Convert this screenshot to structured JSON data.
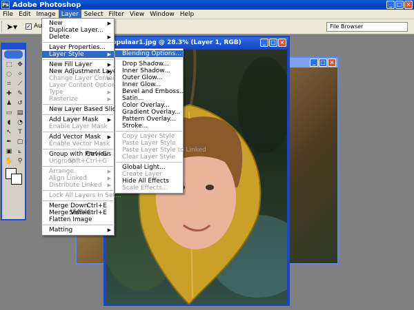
{
  "titlebar": {
    "title": "Adobe Photoshop"
  },
  "menubar": {
    "items": [
      "File",
      "Edit",
      "Image",
      "Layer",
      "Select",
      "Filter",
      "View",
      "Window",
      "Help"
    ]
  },
  "options_bar": {
    "auto_label": "Auto",
    "file_browser_label": "File Browser"
  },
  "document": {
    "title": "populaar1.jpg @ 28.3% (Layer 1, RGB)"
  },
  "layer_menu": {
    "items": [
      {
        "label": "New",
        "sub": true
      },
      {
        "label": "Duplicate Layer..."
      },
      {
        "label": "Delete",
        "sub": true
      },
      {
        "sep": true
      },
      {
        "label": "Layer Properties..."
      },
      {
        "label": "Layer Style",
        "sub": true,
        "hl": true
      },
      {
        "sep": true
      },
      {
        "label": "New Fill Layer",
        "sub": true
      },
      {
        "label": "New Adjustment Layer",
        "sub": true
      },
      {
        "label": "Change Layer Content",
        "sub": true,
        "disabled": true
      },
      {
        "label": "Layer Content Options...",
        "disabled": true
      },
      {
        "label": "Type",
        "sub": true,
        "disabled": true
      },
      {
        "label": "Rasterize",
        "sub": true,
        "disabled": true
      },
      {
        "sep": true
      },
      {
        "label": "New Layer Based Slice"
      },
      {
        "sep": true
      },
      {
        "label": "Add Layer Mask",
        "sub": true
      },
      {
        "label": "Enable Layer Mask",
        "disabled": true
      },
      {
        "sep": true
      },
      {
        "label": "Add Vector Mask",
        "sub": true
      },
      {
        "label": "Enable Vector Mask",
        "disabled": true
      },
      {
        "sep": true
      },
      {
        "label": "Group with Previous",
        "shortcut": "Ctrl+G"
      },
      {
        "label": "Ungroup",
        "shortcut": "Shft+Ctrl+G",
        "disabled": true
      },
      {
        "sep": true
      },
      {
        "label": "Arrange",
        "sub": true,
        "disabled": true
      },
      {
        "label": "Align Linked",
        "sub": true,
        "disabled": true
      },
      {
        "label": "Distribute Linked",
        "sub": true,
        "disabled": true
      },
      {
        "sep": true
      },
      {
        "label": "Lock All Layers In Set...",
        "disabled": true
      },
      {
        "sep": true
      },
      {
        "label": "Merge Down",
        "shortcut": "Ctrl+E"
      },
      {
        "label": "Merge Visible",
        "shortcut": "Shft+Ctrl+E"
      },
      {
        "label": "Flatten Image"
      },
      {
        "sep": true
      },
      {
        "label": "Matting",
        "sub": true
      }
    ]
  },
  "layer_style_menu": {
    "items": [
      {
        "label": "Blending Options...",
        "hl": true
      },
      {
        "sep": true
      },
      {
        "label": "Drop Shadow..."
      },
      {
        "label": "Inner Shadow..."
      },
      {
        "label": "Outer Glow..."
      },
      {
        "label": "Inner Glow..."
      },
      {
        "label": "Bevel and Emboss..."
      },
      {
        "label": "Satin..."
      },
      {
        "label": "Color Overlay..."
      },
      {
        "label": "Gradient Overlay..."
      },
      {
        "label": "Pattern Overlay..."
      },
      {
        "label": "Stroke..."
      },
      {
        "sep": true
      },
      {
        "label": "Copy Layer Style",
        "disabled": true
      },
      {
        "label": "Paste Layer Style",
        "disabled": true
      },
      {
        "label": "Paste Layer Style to Linked",
        "disabled": true
      },
      {
        "label": "Clear Layer Style",
        "disabled": true
      },
      {
        "sep": true
      },
      {
        "label": "Global Light..."
      },
      {
        "label": "Create Layer",
        "disabled": true
      },
      {
        "label": "Hide All Effects"
      },
      {
        "label": "Scale Effects...",
        "disabled": true
      }
    ]
  }
}
